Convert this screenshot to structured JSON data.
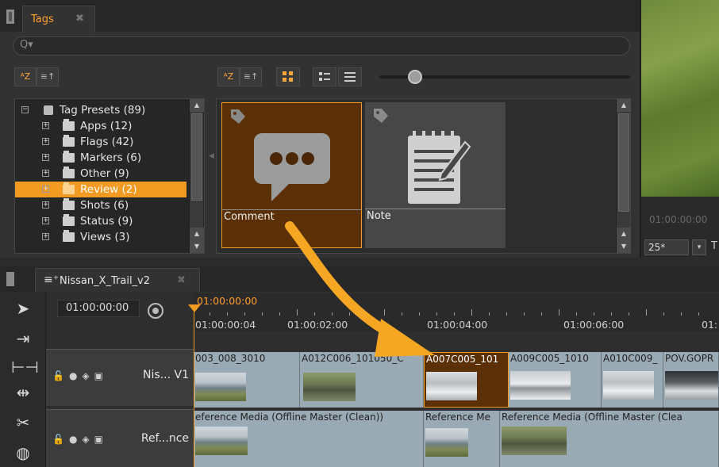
{
  "tags_panel": {
    "tab_label": "Tags",
    "tab_close": "✖",
    "search_icon": "Q▾",
    "sort_az": "ᴬZ",
    "sort_order": "≡↑",
    "tree": [
      {
        "label": "Tag Presets (89)",
        "selected": false
      },
      {
        "label": "Apps (12)",
        "selected": false
      },
      {
        "label": "Flags (42)",
        "selected": false
      },
      {
        "label": "Markers (6)",
        "selected": false
      },
      {
        "label": "Other (9)",
        "selected": false
      },
      {
        "label": "Review (2)",
        "selected": true
      },
      {
        "label": "Shots (6)",
        "selected": false
      },
      {
        "label": "Status (9)",
        "selected": false
      },
      {
        "label": "Views (3)",
        "selected": false
      }
    ],
    "grid_view_icon": "∷",
    "list_view_icon": "≡",
    "tiles": [
      {
        "label": "Comment",
        "icon": "comment-bubble-icon",
        "selected": true
      },
      {
        "label": "Note",
        "icon": "notepad-icon",
        "selected": false
      }
    ]
  },
  "viewer": {
    "timecode": "01:00:00:00",
    "fps": "25*",
    "dropdown": "▾",
    "extra": "T"
  },
  "timeline": {
    "tab_label": "Nissan_X_Trail_v2",
    "tab_close": "✖",
    "current_timecode": "01:00:00:00",
    "ruler": {
      "playhead_tc": "01:00:00:00",
      "labels": [
        "01:00:00:04",
        "01:00:02:00",
        "01:00:04:00",
        "01:00:06:00",
        "01:"
      ]
    },
    "tracks": [
      {
        "name": "Nis... V1"
      },
      {
        "name": "Ref...nce"
      }
    ],
    "v1_clips": [
      {
        "label": "003_008_3010"
      },
      {
        "label": "A012C006_101050_C"
      },
      {
        "label": "A007C005_101"
      },
      {
        "label": "A009C005_1010"
      },
      {
        "label": "A010C009_"
      },
      {
        "label": "POV.GOPR"
      }
    ],
    "ref_clips": [
      {
        "label": "eference Media (Offline Master (Clean))"
      },
      {
        "label": "Reference Me"
      },
      {
        "label": "Reference Media (Offline Master (Clea"
      }
    ]
  },
  "colors": {
    "accent": "#f29a21",
    "selected_tile": "#5b3007",
    "clip": "#9aaab5"
  }
}
